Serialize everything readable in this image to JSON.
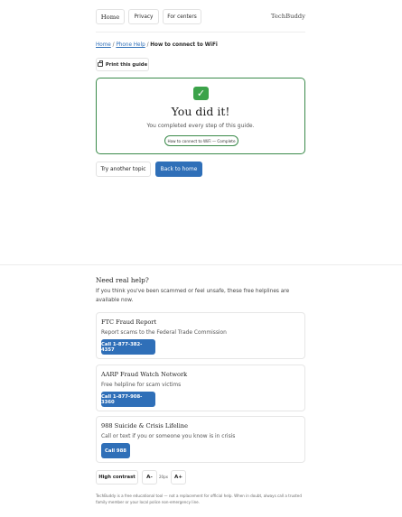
{
  "nav": {
    "home": "Home",
    "privacy": "Privacy",
    "centers": "For centers",
    "brand": "TechBuddy"
  },
  "breadcrumb": {
    "home": "Home",
    "sep1": "/",
    "phone_help": "Phone Help",
    "sep2": "/",
    "current": "How to connect to WiFi"
  },
  "print_label": "Print this guide",
  "completion": {
    "icon": "check-mark",
    "title": "You did it!",
    "subtitle": "You completed every step of this guide.",
    "badge": "How to connect to WiFi — Complete"
  },
  "actions": {
    "another": "Try another topic",
    "home": "Back to home"
  },
  "help": {
    "heading": "Need real help?",
    "intro": "If you think you've been scammed or feel unsafe, these free helplines are available now.",
    "lines": [
      {
        "name": "FTC Fraud Report",
        "desc": "Report scams to the Federal Trade Commission",
        "call": "Call 1-877-382-4357"
      },
      {
        "name": "AARP Fraud Watch Network",
        "desc": "Free helpline for scam victims",
        "call": "Call 1-877-908-3360"
      },
      {
        "name": "988 Suicide & Crisis Lifeline",
        "desc": "Call or text if you or someone you know is in crisis",
        "call": "Call 988"
      }
    ]
  },
  "accessibility": {
    "contrast": "High contrast",
    "decrease": "A-",
    "size": "20px",
    "increase": "A+"
  },
  "footer": "TechBuddy is a free educational tool — not a replacement for official help. When in doubt, always call a trusted family member or your local police non-emergency line.",
  "colors": {
    "accent": "#2f6fb8",
    "success": "#3a8a4a"
  }
}
